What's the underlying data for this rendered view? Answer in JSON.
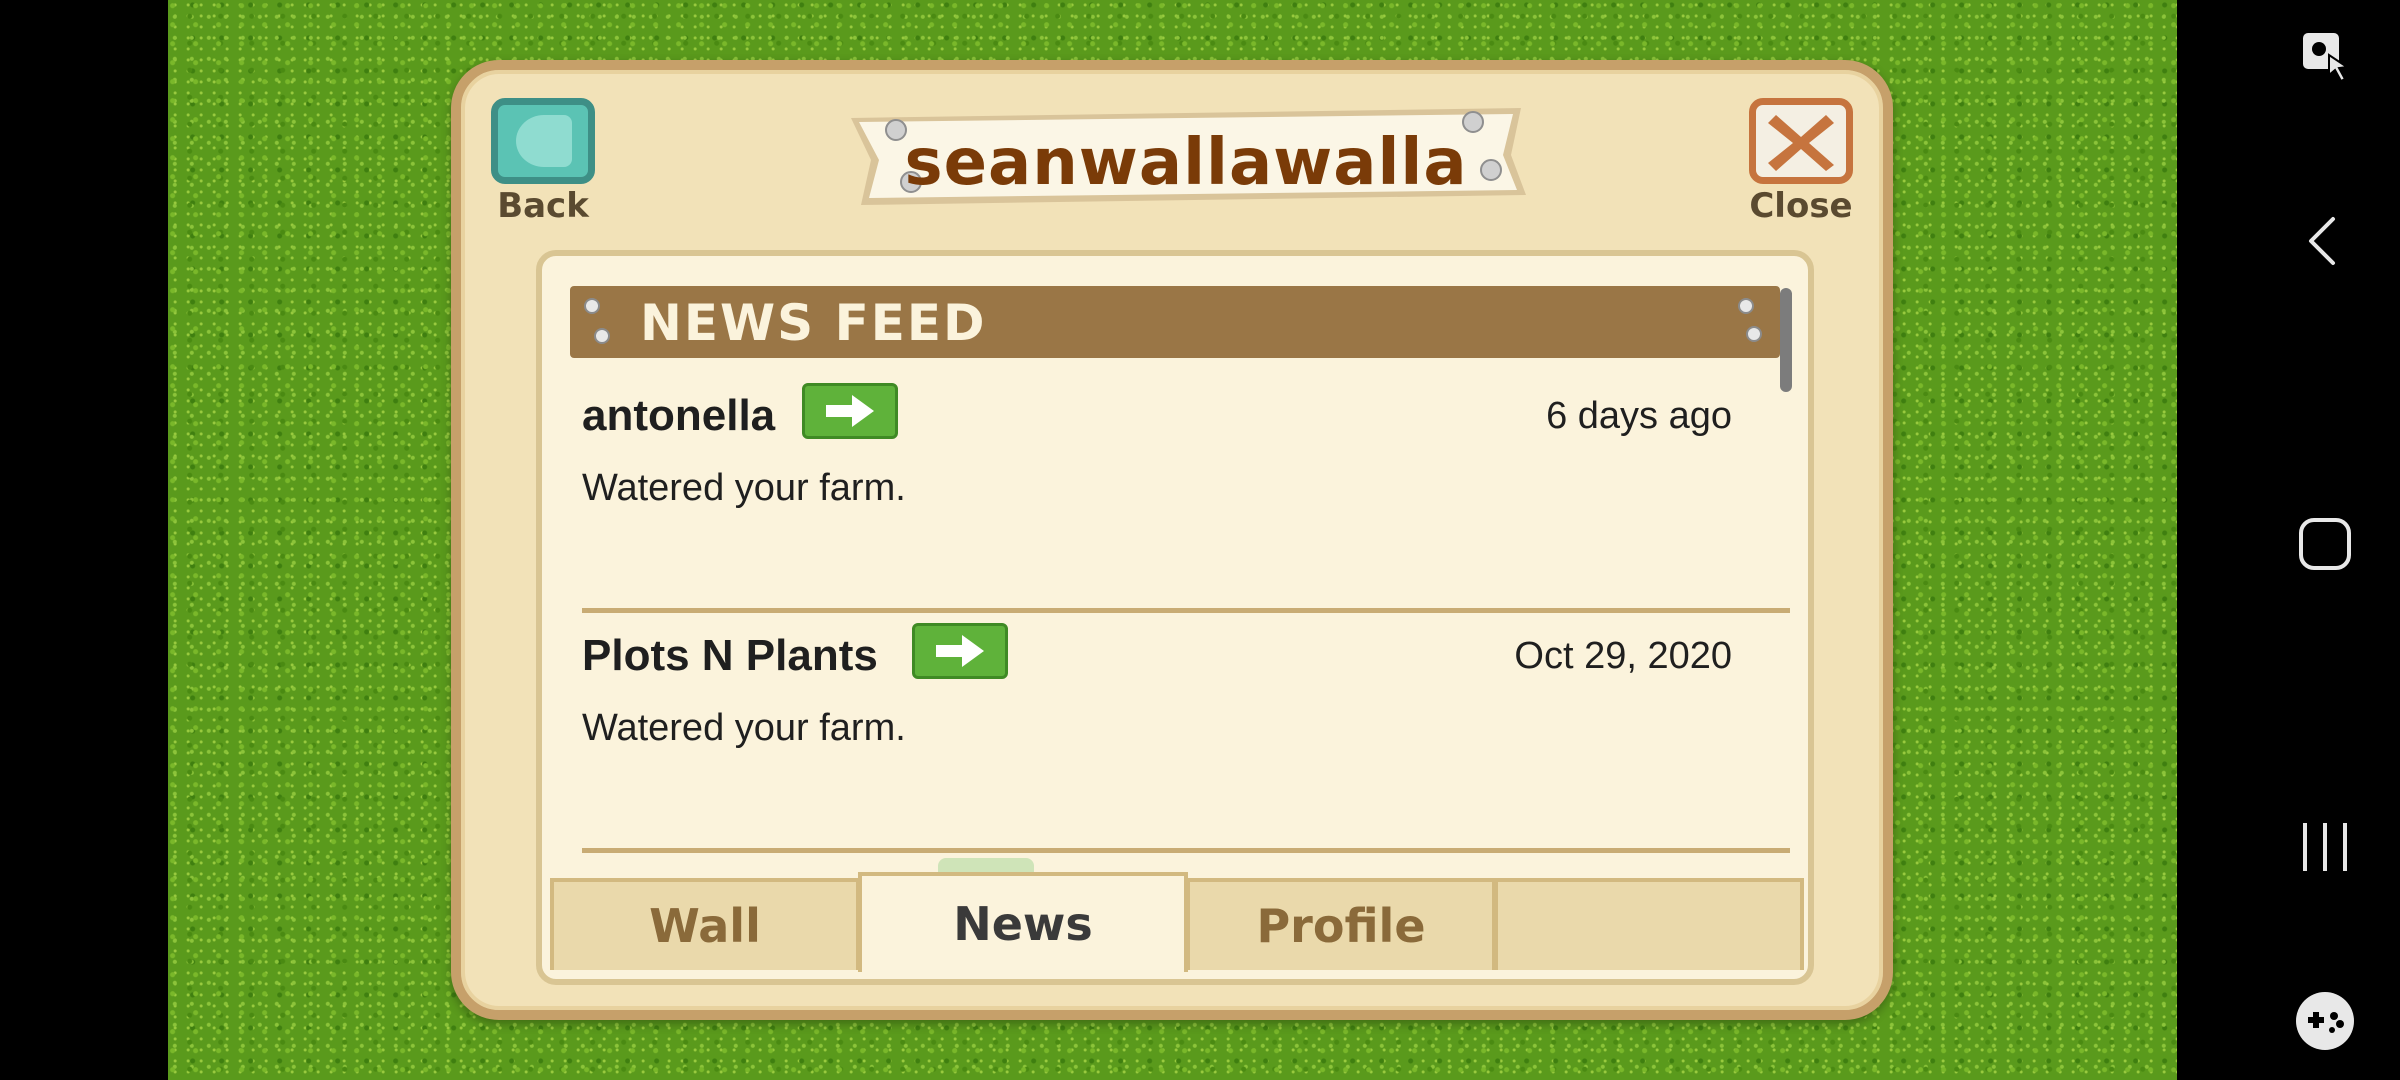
{
  "dialog": {
    "title": "seanwallawalla",
    "back_label": "Back",
    "close_label": "Close"
  },
  "news_feed": {
    "heading": "NEWS FEED",
    "entries": [
      {
        "name": "antonella",
        "time": "6 days ago",
        "message": "Watered your farm."
      },
      {
        "name": "Plots N Plants",
        "time": "Oct 29, 2020",
        "message": "Watered your farm."
      }
    ]
  },
  "tabs": [
    {
      "label": "Wall"
    },
    {
      "label": "News"
    },
    {
      "label": "Profile"
    },
    {
      "label": ""
    }
  ],
  "active_tab": "News",
  "icons": {
    "back": "back-arrow-icon",
    "close": "close-x-icon",
    "go": "right-arrow-icon",
    "nav": [
      "accessibility-icon",
      "back-nav-icon",
      "home-nav-icon",
      "recents-nav-icon",
      "game-controller-icon"
    ]
  },
  "colors": {
    "grass": "#5a9a1c",
    "dialog_bg": "#f2e2b8",
    "banner": "#9a7646",
    "title_text": "#7a3b08",
    "go_button": "#5fb23a",
    "back_button": "#5bc3b4",
    "close_border": "#c6743e"
  }
}
